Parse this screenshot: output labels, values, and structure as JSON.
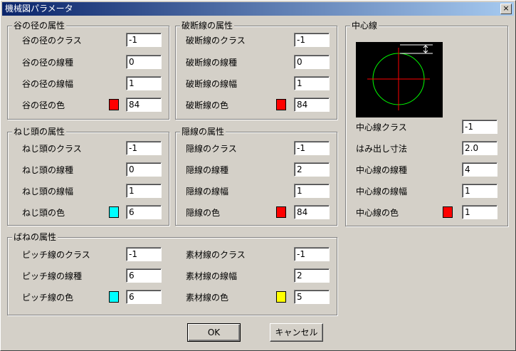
{
  "window": {
    "title": "機械図パラメータ",
    "close_glyph": "×"
  },
  "groups": {
    "root": {
      "title": "谷の径の属性",
      "rows": [
        {
          "label": "谷の径のクラス",
          "value": "-1"
        },
        {
          "label": "谷の径の線種",
          "value": "0"
        },
        {
          "label": "谷の径の線幅",
          "value": "1"
        },
        {
          "label": "谷の径の色",
          "value": "84",
          "swatch": "#ff0000"
        }
      ]
    },
    "break": {
      "title": "破断線の属性",
      "rows": [
        {
          "label": "破断線のクラス",
          "value": "-1"
        },
        {
          "label": "破断線の線種",
          "value": "0"
        },
        {
          "label": "破断線の線幅",
          "value": "1"
        },
        {
          "label": "破断線の色",
          "value": "84",
          "swatch": "#ff0000"
        }
      ]
    },
    "screw": {
      "title": "ねじ頭の属性",
      "rows": [
        {
          "label": "ねじ頭のクラス",
          "value": "-1"
        },
        {
          "label": "ねじ頭の線種",
          "value": "0"
        },
        {
          "label": "ねじ頭の線幅",
          "value": "1"
        },
        {
          "label": "ねじ頭の色",
          "value": "6",
          "swatch": "#00ffff"
        }
      ]
    },
    "hidden": {
      "title": "隠線の属性",
      "rows": [
        {
          "label": "隠線のクラス",
          "value": "-1"
        },
        {
          "label": "隠線の線種",
          "value": "2"
        },
        {
          "label": "隠線の線幅",
          "value": "1"
        },
        {
          "label": "隠線の色",
          "value": "84",
          "swatch": "#ff0000"
        }
      ]
    },
    "spring": {
      "title": "ばねの属性",
      "left": [
        {
          "label": "ピッチ線のクラス",
          "value": "-1"
        },
        {
          "label": "ピッチ線の線種",
          "value": "6"
        },
        {
          "label": "ピッチ線の色",
          "value": "6",
          "swatch": "#00ffff"
        }
      ],
      "right": [
        {
          "label": "素材線のクラス",
          "value": "-1"
        },
        {
          "label": "素材線の線幅",
          "value": "2"
        },
        {
          "label": "素材線の色",
          "value": "5",
          "swatch": "#ffff00"
        }
      ]
    },
    "center": {
      "title": "中心線",
      "rows": [
        {
          "label": "中心線クラス",
          "value": "-1"
        },
        {
          "label": "はみ出し寸法",
          "value": "2.0"
        },
        {
          "label": "中心線の線種",
          "value": "4"
        },
        {
          "label": "中心線の線幅",
          "value": "1"
        },
        {
          "label": "中心線の色",
          "value": "1",
          "swatch": "#ff0000"
        }
      ]
    }
  },
  "buttons": {
    "ok": "OK",
    "cancel": "キャンセル"
  },
  "colors": {
    "titlebar_start": "#0a246a",
    "dialog_bg": "#d4d0c8",
    "preview_circle": "#00ff00",
    "preview_axis": "#ff0000"
  }
}
